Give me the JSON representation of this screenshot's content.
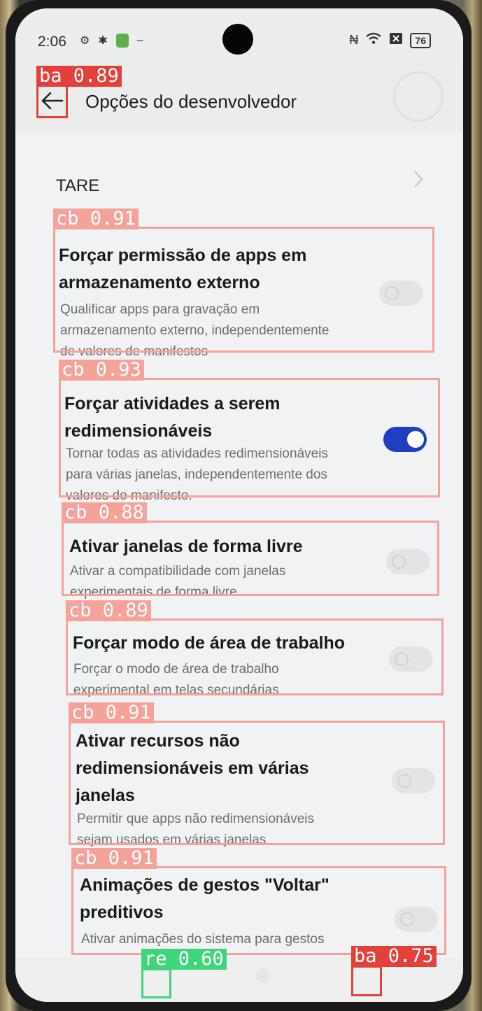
{
  "status_bar": {
    "time": "2:06",
    "icons": [
      "settings-gear-icon",
      "bug-icon",
      "app-green-icon",
      "minus-icon"
    ],
    "right_icons": [
      "nfc-icon",
      "wifi-icon",
      "sim-x-icon"
    ],
    "battery": "76"
  },
  "header": {
    "title": "Opções do desenvolvedor"
  },
  "section": {
    "label": "TARE"
  },
  "settings": [
    {
      "title_lines": [
        "Forçar permissão de apps em",
        "armazenamento externo"
      ],
      "desc_lines": [
        "Qualificar apps para gravação em",
        "armazenamento externo, independentemente",
        "de valores de manifestos"
      ],
      "enabled": false
    },
    {
      "title_lines": [
        "Forçar atividades a serem",
        "redimensionáveis"
      ],
      "desc_lines": [
        "Tornar todas as atividades redimensionáveis",
        "para várias janelas, independentemente dos",
        "valores do manifesto."
      ],
      "enabled": true
    },
    {
      "title_lines": [
        "Ativar janelas de forma livre"
      ],
      "desc_lines": [
        "Ativar a compatibilidade com janelas",
        "experimentais de forma livre."
      ],
      "enabled": false
    },
    {
      "title_lines": [
        "Forçar modo de área de trabalho"
      ],
      "desc_lines": [
        "Forçar o modo de área de trabalho",
        "experimental em telas secundárias"
      ],
      "enabled": false
    },
    {
      "title_lines": [
        "Ativar recursos não",
        "redimensionáveis em várias",
        "janelas"
      ],
      "desc_lines": [
        "Permitir que apps não redimensionáveis",
        "sejam usados em várias janelas"
      ],
      "enabled": false
    },
    {
      "title_lines": [
        "Animações de gestos \"Voltar\"",
        "preditivos"
      ],
      "desc_lines": [
        "Ativar animações do sistema para gestos"
      ],
      "enabled": false
    }
  ],
  "detections": [
    {
      "label": "ba 0.89",
      "color": "#e3403a"
    },
    {
      "label": "cb 0.91",
      "color": "#f4a29a"
    },
    {
      "label": "cb 0.93",
      "color": "#f4a29a"
    },
    {
      "label": "cb 0.88",
      "color": "#f4a29a"
    },
    {
      "label": "cb 0.89",
      "color": "#f4a29a"
    },
    {
      "label": "cb 0.91",
      "color": "#f4a29a"
    },
    {
      "label": "cb 0.91",
      "color": "#f4a29a"
    },
    {
      "label": "re 0.60",
      "color": "#3fd57a"
    },
    {
      "label": "ba 0.75",
      "color": "#e3403a"
    }
  ]
}
